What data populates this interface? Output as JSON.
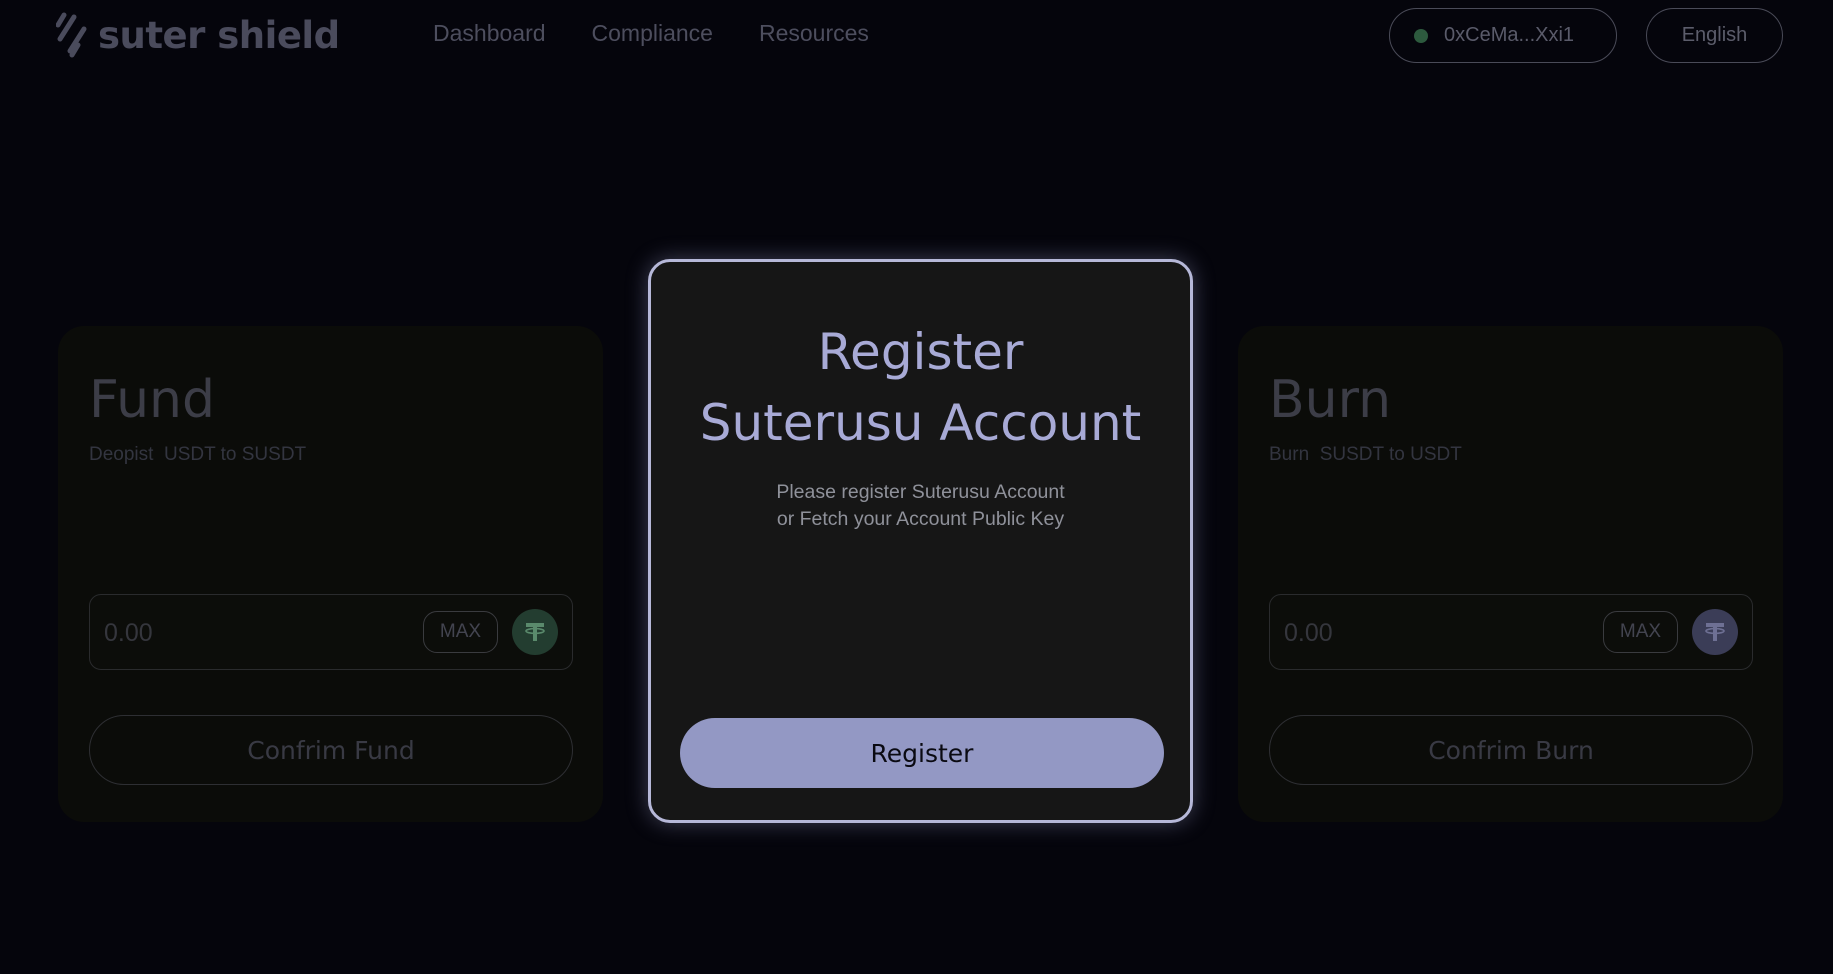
{
  "header": {
    "logo_text": "suter shield",
    "nav": [
      "Dashboard",
      "Compliance",
      "Resources"
    ],
    "wallet_address": "0xCeMa...Xxi1",
    "wallet_status_color": "#2d5a3e",
    "language": "English"
  },
  "fund": {
    "title": "Fund",
    "subtitle": "Deopist  USDT to SUSDT",
    "amount_placeholder": "0.00",
    "max_label": "MAX",
    "token_icon": "tether-icon",
    "confirm_label": "Confrim Fund"
  },
  "register": {
    "title_line1": "Register",
    "title_line2": "Suterusu Account",
    "desc_line1": "Please register Suterusu Account",
    "desc_line2": "or Fetch your Account Public Key",
    "button_label": "Register",
    "accent_color": "#9398c4"
  },
  "burn": {
    "title": "Burn",
    "subtitle": "Burn  SUSDT to USDT",
    "amount_placeholder": "0.00",
    "max_label": "MAX",
    "token_icon": "susdt-icon",
    "confirm_label": "Confrim Burn"
  }
}
